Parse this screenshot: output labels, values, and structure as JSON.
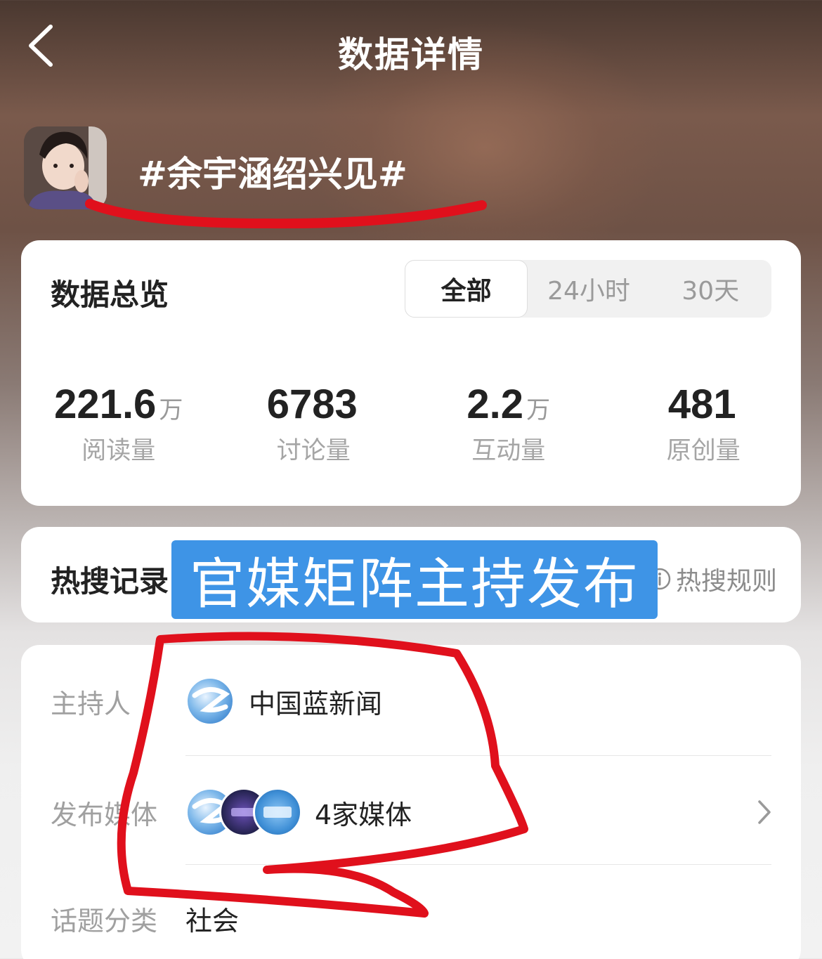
{
  "header": {
    "title": "数据详情"
  },
  "topic": {
    "title": "#余宇涵绍兴见#"
  },
  "overview": {
    "title": "数据总览",
    "tabs": [
      {
        "label": "全部",
        "active": true
      },
      {
        "label": "24小时",
        "active": false
      },
      {
        "label": "30天",
        "active": false
      }
    ],
    "stats": [
      {
        "value": "221.6",
        "unit": "万",
        "label": "阅读量"
      },
      {
        "value": "6783",
        "unit": "",
        "label": "讨论量"
      },
      {
        "value": "2.2",
        "unit": "万",
        "label": "互动量"
      },
      {
        "value": "481",
        "unit": "",
        "label": "原创量"
      }
    ]
  },
  "hot_search": {
    "title": "热搜记录",
    "rules_label": "热搜规则"
  },
  "overlay_banner": "官媒矩阵主持发布",
  "info": {
    "host_label": "主持人",
    "host_name": "中国蓝新闻",
    "media_label": "发布媒体",
    "media_count": "4家媒体",
    "category_label": "话题分类",
    "category_value": "社会"
  },
  "colors": {
    "banner": "#3e94e6",
    "annotation_red": "#e0101c",
    "card_bg": "#ffffff"
  },
  "icons": [
    "back-arrow-icon",
    "chevron-right-icon",
    "info-icon"
  ]
}
